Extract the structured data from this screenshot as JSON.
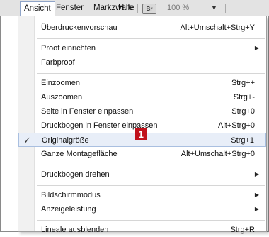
{
  "menubar": {
    "items": [
      "Ansicht",
      "Fenster",
      "Markzware",
      "Hilfe"
    ],
    "br_label": "Br",
    "zoom": "100 %",
    "zoom_arrow": "▼"
  },
  "menu": {
    "overprint": {
      "label": "Überdruckenvorschau",
      "shortcut": "Alt+Umschalt+Strg+Y"
    },
    "proof_setup": {
      "label": "Proof einrichten"
    },
    "color_proof": {
      "label": "Farbproof"
    },
    "zoom_in": {
      "label": "Einzoomen",
      "shortcut": "Strg++"
    },
    "zoom_out": {
      "label": "Auszoomen",
      "shortcut": "Strg+-"
    },
    "fit_page": {
      "label": "Seite in Fenster einpassen",
      "shortcut": "Strg+0"
    },
    "fit_spread": {
      "label": "Druckbogen in Fenster einpassen",
      "shortcut": "Alt+Strg+0"
    },
    "actual_size": {
      "label": "Originalgröße",
      "shortcut": "Strg+1",
      "check": "✓"
    },
    "pasteboard": {
      "label": "Ganze Montagefläche",
      "shortcut": "Alt+Umschalt+Strg+0"
    },
    "rotate_spread": {
      "label": "Druckbogen drehen"
    },
    "screen_mode": {
      "label": "Bildschirmmodus"
    },
    "display_performance": {
      "label": "Anzeigeleistung"
    },
    "hide_rulers": {
      "label": "Lineale ausblenden",
      "shortcut": "Strg+R"
    },
    "submenu_arrow": "▶"
  },
  "badge": "1",
  "colors": {
    "badge": "#c1121c",
    "highlight_bg": "#e8eef8",
    "highlight_border": "#a9bfe0"
  }
}
